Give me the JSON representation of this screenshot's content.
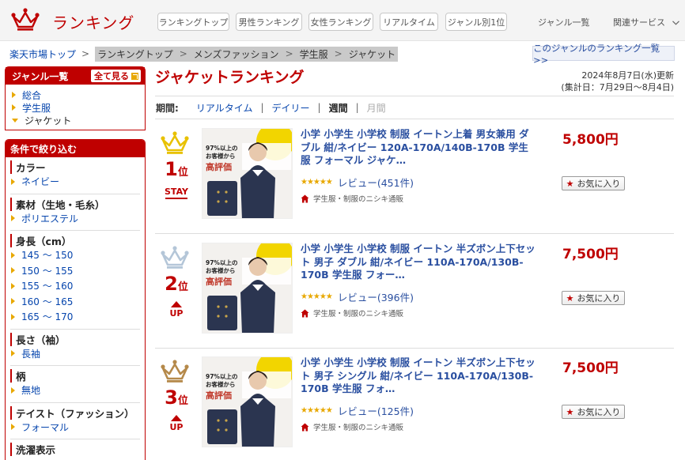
{
  "header": {
    "logo_text": "ランキング",
    "tabs": [
      "ランキングトップ",
      "男性ランキング",
      "女性ランキング",
      "リアルタイム",
      "ジャンル別1位"
    ],
    "genre_list": "ジャンル一覧",
    "related": "関連サービス"
  },
  "breadcrumb": {
    "root": "楽天市場トップ",
    "sep": ">",
    "items": [
      "ランキングトップ",
      "メンズファッション",
      "学生服",
      "ジャケット"
    ],
    "all_genre_link": "このジャンルのランキング一覧 >>"
  },
  "sidebar": {
    "genre_title": "ジャンル一覧",
    "show_all": "全て見る",
    "genres": [
      "総合",
      "学生服",
      "ジャケット"
    ],
    "filter_title": "条件で絞り込む",
    "filters": [
      {
        "title": "カラー",
        "items": [
          "ネイビー"
        ]
      },
      {
        "title": "素材（生地・毛糸）",
        "items": [
          "ポリエステル"
        ]
      },
      {
        "title": "身長（cm）",
        "items": [
          "145 ～ 150",
          "150 ～ 155",
          "155 ～ 160",
          "160 ～ 165",
          "165 ～ 170"
        ]
      },
      {
        "title": "長さ（袖）",
        "items": [
          "長袖"
        ]
      },
      {
        "title": "柄",
        "items": [
          "無地"
        ]
      },
      {
        "title": "テイスト（ファッション）",
        "items": [
          "フォーマル"
        ]
      },
      {
        "title": "洗濯表示",
        "items": []
      }
    ]
  },
  "main": {
    "title": "ジャケットランキング",
    "updated": "2024年8月7日(水)更新",
    "aggregation": "(集計日：7月29日～8月4日)",
    "period": {
      "label": "期間:",
      "options": [
        "リアルタイム",
        "デイリー",
        "週間",
        "月間"
      ],
      "sep": "|"
    },
    "items": [
      {
        "rank": "1",
        "rank_suffix": "位",
        "status": "STAY",
        "crown_color": "#e8c100",
        "title": "小学 小学生 小学校 制服 イートン上着 男女兼用 ダブル 紺/ネイビー 120A-170A/140B-170B 学生服 フォーマル ジャケ…",
        "stars": "★★★★★",
        "review": "レビュー(451件)",
        "shop": "学生服・制服のニシキ通販",
        "price": "5,800円",
        "fav": "お気に入り",
        "thumb_pct": "97%以上の",
        "thumb_line2": "お客様から",
        "thumb_badge": "高評価"
      },
      {
        "rank": "2",
        "rank_suffix": "位",
        "status": "UP",
        "crown_color": "#b4c6d8",
        "title": "小学 小学生 小学校 制服 イートン 半ズボン上下セット 男子 ダブル 紺/ネイビー 110A-170A/130B-170B 学生服 フォー…",
        "stars": "★★★★★",
        "review": "レビュー(396件)",
        "shop": "学生服・制服のニシキ通販",
        "price": "7,500円",
        "fav": "お気に入り",
        "thumb_pct": "97%以上の",
        "thumb_line2": "お客様から",
        "thumb_badge": "高評価"
      },
      {
        "rank": "3",
        "rank_suffix": "位",
        "status": "UP",
        "crown_color": "#b5894a",
        "title": "小学 小学生 小学校 制服 イートン 半ズボン上下セット 男子 シングル 紺/ネイビー 110A-170A/130B-170B 学生服 フォ…",
        "stars": "★★★★★",
        "review": "レビュー(125件)",
        "shop": "学生服・制服のニシキ通販",
        "price": "7,500円",
        "fav": "お気に入り",
        "thumb_pct": "97%以上の",
        "thumb_line2": "お客様から",
        "thumb_badge": "高評価"
      }
    ]
  }
}
